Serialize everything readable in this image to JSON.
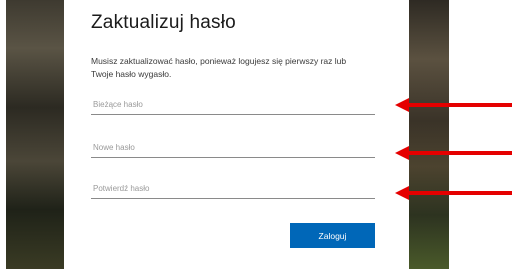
{
  "dialog": {
    "title": "Zaktualizuj hasło",
    "description": "Musisz zaktualizować hasło, ponieważ logujesz się pierwszy raz lub Twoje hasło wygasło."
  },
  "fields": {
    "current_password": {
      "placeholder": "Bieżące hasło",
      "value": ""
    },
    "new_password": {
      "placeholder": "Nowe hasło",
      "value": ""
    },
    "confirm_password": {
      "placeholder": "Potwierdź hasło",
      "value": ""
    }
  },
  "submit_button": {
    "label": "Zaloguj"
  },
  "colors": {
    "button_accent": "#0067b8",
    "arrow": "#e50000"
  },
  "annotations": [
    {
      "icon": "arrow-left-icon",
      "points_to": "current_password"
    },
    {
      "icon": "arrow-left-icon",
      "points_to": "new_password"
    },
    {
      "icon": "arrow-left-icon",
      "points_to": "confirm_password"
    }
  ]
}
